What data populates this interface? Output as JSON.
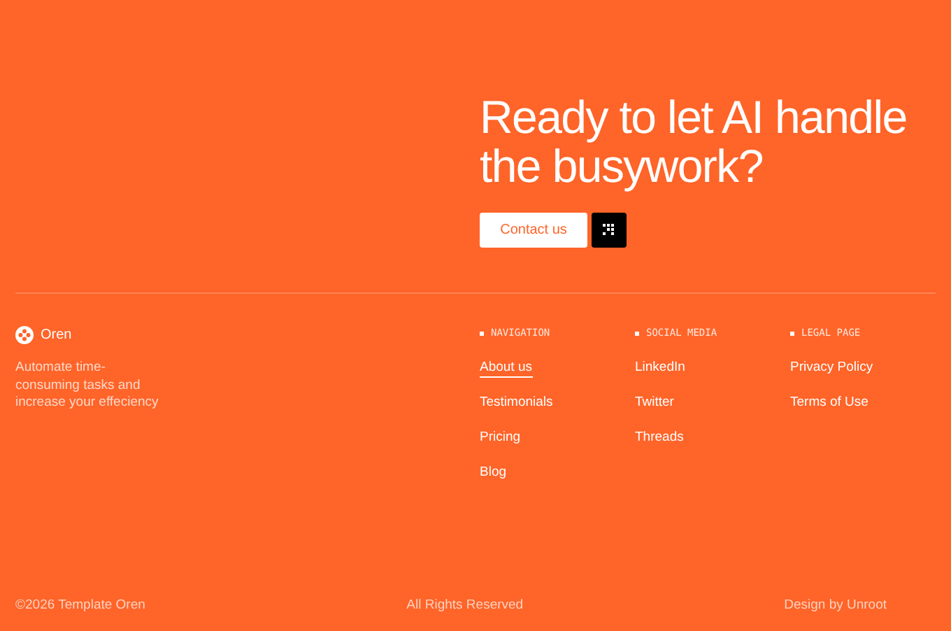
{
  "cta": {
    "heading": "Ready to let AI handle the busywork?",
    "button": "Contact us"
  },
  "brand": {
    "name": "Oren",
    "tagline": "Automate time-consuming tasks and increase your effeciency"
  },
  "columns": [
    {
      "title": "NAVIGATION",
      "links": [
        {
          "label": "About us",
          "selected": true
        },
        {
          "label": "Testimonials",
          "selected": false
        },
        {
          "label": "Pricing",
          "selected": false
        },
        {
          "label": "Blog",
          "selected": false
        }
      ]
    },
    {
      "title": "SOCIAL MEDIA",
      "links": [
        {
          "label": "LinkedIn",
          "selected": false
        },
        {
          "label": "Twitter",
          "selected": false
        },
        {
          "label": "Threads",
          "selected": false
        }
      ]
    },
    {
      "title": "LEGAL PAGE",
      "links": [
        {
          "label": "Privacy Policy",
          "selected": false
        },
        {
          "label": "Terms of Use",
          "selected": false
        }
      ]
    }
  ],
  "bottom": {
    "copyright": "©2026 Template Oren",
    "rights": "All Rights Reserved",
    "credit": "Design by Unroot"
  }
}
